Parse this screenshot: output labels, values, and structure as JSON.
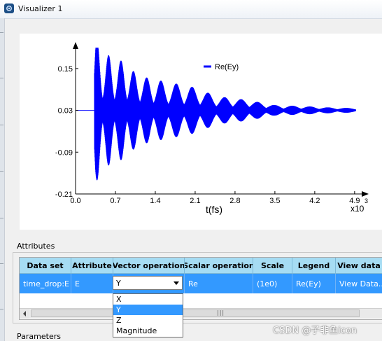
{
  "window": {
    "title": "Visualizer 1"
  },
  "chart_data": {
    "type": "line",
    "title": "",
    "xlabel": "t(fs)",
    "x_multiplier_label": "x10",
    "x_multiplier_exp": "3",
    "ylabel": "",
    "xlim": [
      0.0,
      5.0
    ],
    "ylim": [
      -0.21,
      0.21
    ],
    "x_ticks": [
      "0.0",
      "0.7",
      "1.4",
      "2.1",
      "2.8",
      "3.5",
      "4.2",
      "4.9"
    ],
    "y_ticks": [
      "0.15",
      "0.03",
      "-0.09",
      "-0.21"
    ],
    "legend": "top-center",
    "grid": false,
    "series": [
      {
        "name": "Re(Ey)",
        "color": "#0000ff",
        "envelope": {
          "x": [
            0.0,
            0.2,
            0.35,
            0.5,
            0.7,
            0.9,
            1.1,
            1.35,
            1.65,
            2.0,
            2.5,
            3.0,
            3.5,
            4.0,
            4.5,
            5.0
          ],
          "y": [
            0.0,
            0.005,
            0.21,
            0.16,
            0.155,
            0.13,
            0.1,
            0.09,
            0.08,
            0.07,
            0.04,
            0.03,
            0.015,
            0.012,
            0.008,
            0.006
          ]
        },
        "pulse_centers": [
          0.38,
          0.58,
          0.8,
          1.02,
          1.25,
          1.5,
          1.77,
          2.05,
          2.33,
          2.62,
          2.91,
          3.2,
          3.5,
          3.81,
          4.12,
          4.44,
          4.76
        ]
      }
    ]
  },
  "attributes": {
    "label": "Attributes",
    "columns": [
      "Data set",
      "Attribute",
      "Vector operation",
      "Scalar operation",
      "Scale",
      "Legend",
      "View data"
    ],
    "row": {
      "data_set": "time_drop:E",
      "attribute": "E",
      "vector_operation": "Y",
      "scalar_operation": "Re",
      "scale": "(1e0)",
      "legend": "Re(Ey)",
      "view_data": "View Data..."
    },
    "dropdown_options": [
      "X",
      "Y",
      "Z",
      "Magnitude"
    ],
    "selected_option": "Y"
  },
  "parameters": {
    "label": "Parameters"
  },
  "watermark": "CSDN @子非鱼icon"
}
